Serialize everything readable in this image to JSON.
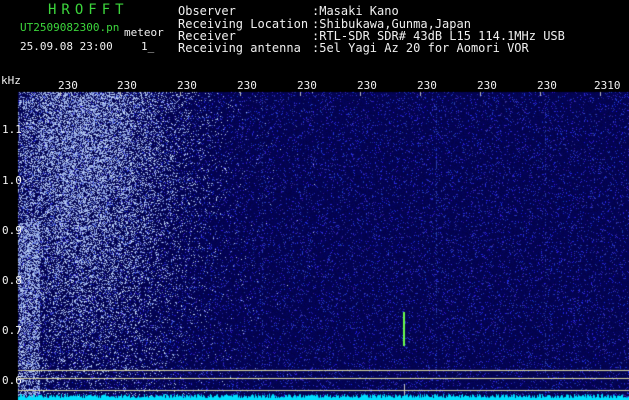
{
  "header": {
    "brand": "HROFFT",
    "filename": "UT2509082300.pn",
    "subtitle": "meteor",
    "datetime": "25.09.08 23:00",
    "counter": "1_",
    "info_labels": [
      "Observer",
      "Receiving Location",
      "Receiver",
      "Receiving antenna"
    ],
    "info_values": [
      ":Masaki Kano",
      ":Shibukawa,Gunma,Japan",
      ":RTL-SDR SDR# 43dB L15 114.1MHz USB",
      ":5el Yagi Az 20 for Aomori VOR"
    ]
  },
  "colors": {
    "background": "#000000",
    "waterfall_base": "#050555",
    "header_green": "#3cd63c",
    "guide_lines": "#d8d8a0",
    "spectrum": "#00e0ff"
  },
  "chart_data": {
    "type": "heatmap",
    "ylabel": "kHz",
    "y_ticks": [
      "1.1",
      "1.0",
      "0.9",
      "0.8",
      "0.7",
      "0.6"
    ],
    "x_ticks": [
      "230",
      "230",
      "230",
      "230",
      "230",
      "230",
      "230",
      "230",
      "230",
      "2310"
    ]
  }
}
